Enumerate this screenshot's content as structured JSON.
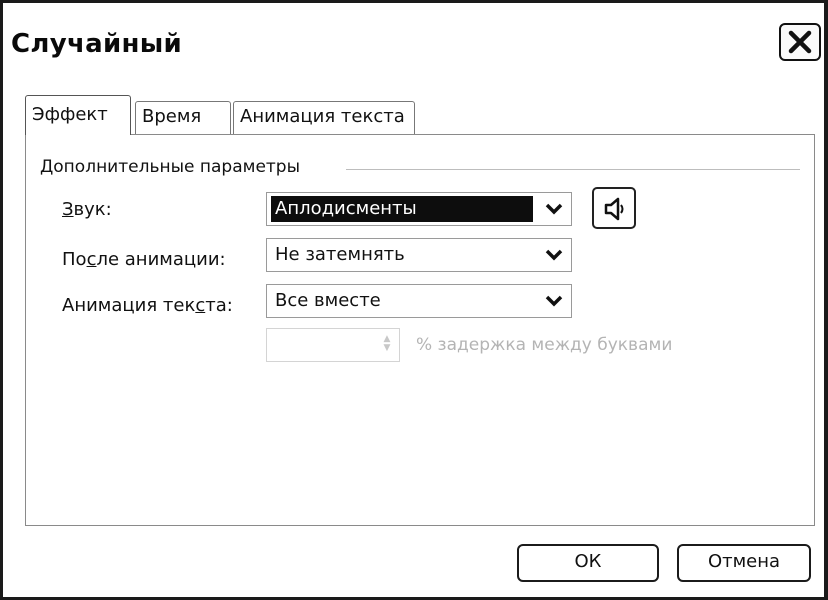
{
  "window": {
    "title": "Случайный",
    "close_icon": "close-icon"
  },
  "tabs": [
    {
      "label": "Эффект",
      "active": true
    },
    {
      "label": "Время",
      "active": false
    },
    {
      "label": "Анимация текста",
      "active": false
    }
  ],
  "group": {
    "legend": "Дополнительные параметры"
  },
  "rows": {
    "sound": {
      "label_pre": "",
      "label_access": "З",
      "label_post": "вук:",
      "value": "Аплодисменты"
    },
    "after": {
      "label_pre": "По",
      "label_access": "с",
      "label_post": "ле анимации:",
      "value": "Не затемнять"
    },
    "text_anim": {
      "label_pre": "Анимация тек",
      "label_access": "с",
      "label_post": "та:",
      "value": "Все вместе"
    }
  },
  "sound_button": {
    "icon": "speaker-icon"
  },
  "delay": {
    "value": "",
    "label": "% задержка между буквами",
    "enabled": false
  },
  "buttons": {
    "ok": "ОК",
    "cancel": "Отмена"
  },
  "colors": {
    "highlight_bg": "#0d0d0d",
    "highlight_text": "#ffffff",
    "disabled_text": "#b4b4b4"
  }
}
